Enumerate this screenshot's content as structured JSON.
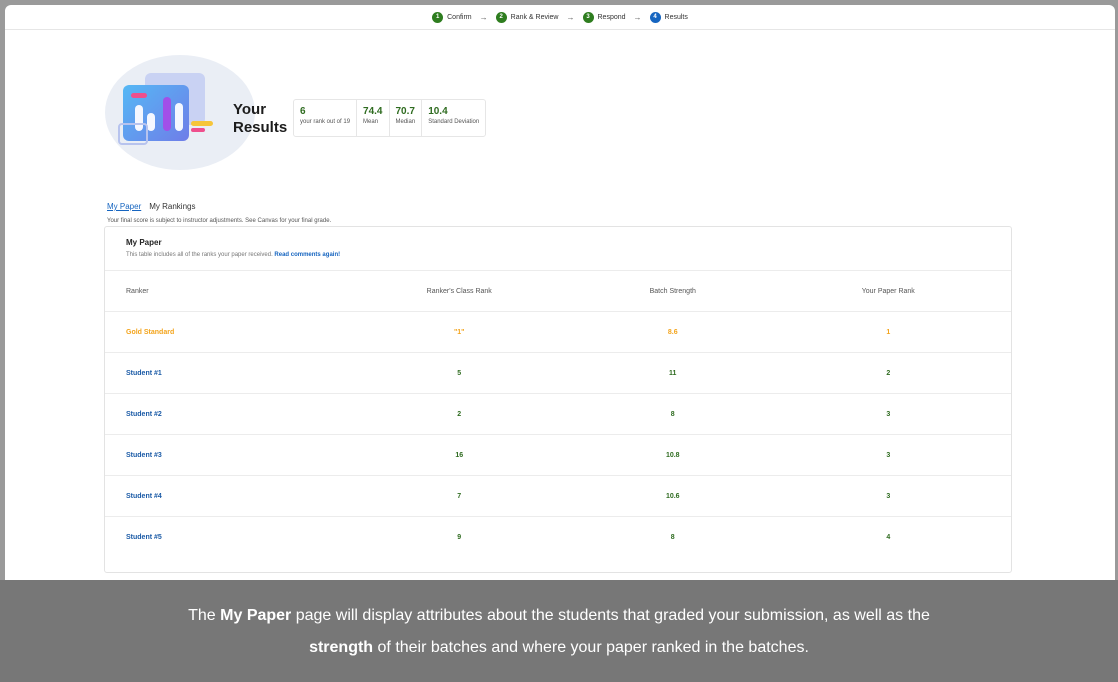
{
  "stepper": [
    {
      "num": "1",
      "label": "Confirm"
    },
    {
      "num": "2",
      "label": "Rank & Review"
    },
    {
      "num": "3",
      "label": "Respond"
    },
    {
      "num": "4",
      "label": "Results"
    }
  ],
  "stepper_arrow": "→",
  "results": {
    "title_line1": "Your",
    "title_line2": "Results"
  },
  "stats": [
    {
      "value": "6",
      "label": "your rank out of 19"
    },
    {
      "value": "74.4",
      "label": "Mean"
    },
    {
      "value": "70.7",
      "label": "Median"
    },
    {
      "value": "10.4",
      "label": "Standard Deviation"
    }
  ],
  "tabs": {
    "my_paper": "My Paper",
    "my_rankings": "My Rankings"
  },
  "note": "Your final score is subject to instructor adjustments. See Canvas for your final grade.",
  "card": {
    "title": "My Paper",
    "subtitle": "This table includes all of the ranks your paper received.",
    "link": "Read comments again!"
  },
  "table": {
    "headers": [
      "Ranker",
      "Ranker's Class Rank",
      "Batch Strength",
      "Your Paper Rank"
    ],
    "rows": [
      [
        "Gold Standard",
        "\"1\"",
        "8.6",
        "1"
      ],
      [
        "Student #1",
        "5",
        "11",
        "2"
      ],
      [
        "Student #2",
        "2",
        "8",
        "3"
      ],
      [
        "Student #3",
        "16",
        "10.8",
        "3"
      ],
      [
        "Student #4",
        "7",
        "10.6",
        "3"
      ],
      [
        "Student #5",
        "9",
        "8",
        "4"
      ]
    ]
  },
  "caption": {
    "p1": "The ",
    "b1": "My Paper",
    "p2": " page will display attributes about the students that graded your submission, as well as the",
    "b2": "strength",
    "p3": " of their batches and where your paper ranked in the batches."
  },
  "colors": {
    "done_step": "#2e7d1f",
    "active_step": "#1665c0",
    "gold": "#f3a41c",
    "student_link": "#1a5aa6",
    "value_green": "#2e6b1f"
  }
}
